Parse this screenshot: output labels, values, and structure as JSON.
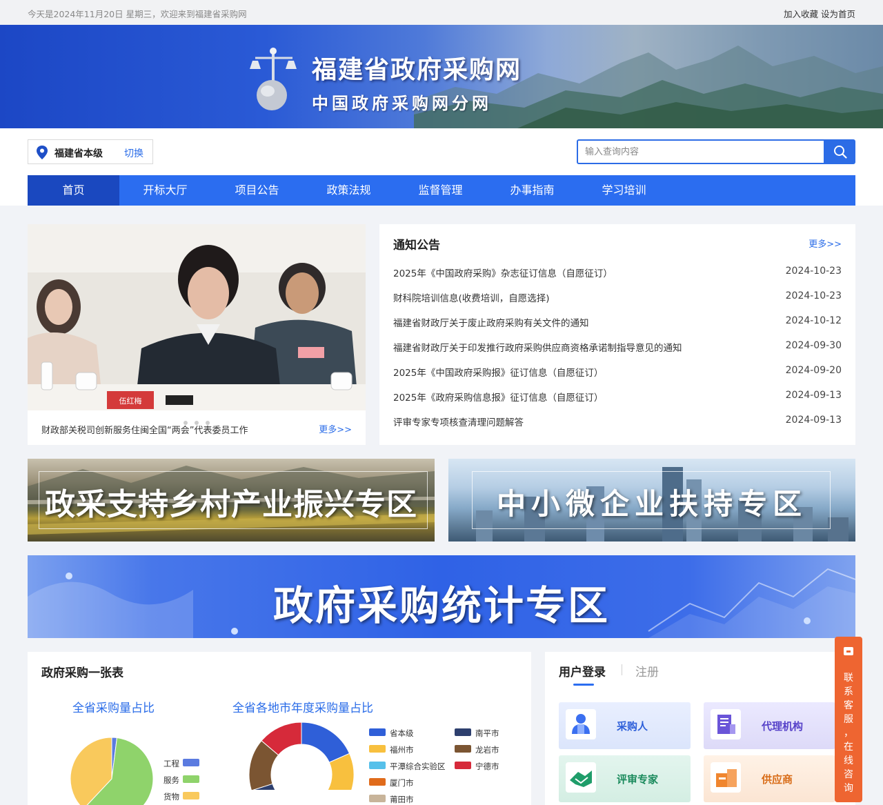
{
  "topbar": {
    "welcome": "今天是2024年11月20日 星期三，欢迎来到福建省采购网",
    "bookmark": "加入收藏",
    "homepage": "设为首页"
  },
  "banner": {
    "title": "福建省政府采购网",
    "subtitle": "中国政府采购网分网"
  },
  "region": {
    "name": "福建省本级",
    "switch_label": "切换"
  },
  "search": {
    "placeholder": "输入查询内容"
  },
  "nav": {
    "items": [
      "首页",
      "开标大厅",
      "项目公告",
      "政策法规",
      "监督管理",
      "办事指南",
      "学习培训"
    ],
    "active": "首页"
  },
  "slider": {
    "caption": "财政部关税司创新服务住闽全国“两会”代表委员工作",
    "more": "更多>>",
    "nameplate": "伍红梅"
  },
  "notices": {
    "title": "通知公告",
    "more": "更多>>",
    "items": [
      {
        "title": "2025年《中国政府采购》杂志征订信息（自愿征订）",
        "date": "2024-10-23"
      },
      {
        "title": "财科院培训信息(收费培训，自愿选择)",
        "date": "2024-10-23"
      },
      {
        "title": "福建省财政厅关于废止政府采购有关文件的通知",
        "date": "2024-10-12"
      },
      {
        "title": "福建省财政厅关于印发推行政府采购供应商资格承诺制指导意见的通知",
        "date": "2024-09-30"
      },
      {
        "title": "2025年《中国政府采购报》征订信息（自愿征订）",
        "date": "2024-09-20"
      },
      {
        "title": "2025年《政府采购信息报》征订信息（自愿征订）",
        "date": "2024-09-13"
      },
      {
        "title": "评审专家专项核查清理问题解答",
        "date": "2024-09-13"
      }
    ]
  },
  "zones": {
    "rural": "政采支持乡村产业振兴专区",
    "sme": "中小微企业扶持专区",
    "stats": "政府采购统计专区"
  },
  "stats": {
    "title": "政府采购一张表",
    "chart1_title": "全省采购量占比",
    "chart2_title": "全省各地市年度采购量占比"
  },
  "chart_data": [
    {
      "type": "pie",
      "title": "全省采购量占比",
      "categories": [
        "工程",
        "服务",
        "货物"
      ],
      "values": [
        2,
        60,
        38
      ],
      "colors": [
        "#5b7be0",
        "#8fd36b",
        "#f9c95c"
      ],
      "legend": "right"
    },
    {
      "type": "pie",
      "title": "全省各地市年度采购量占比",
      "donut": true,
      "categories": [
        "省本级",
        "福州市",
        "平潭综合实验区",
        "厦门市",
        "莆田市",
        "南平市",
        "龙岩市",
        "宁德市"
      ],
      "values": [
        16,
        18,
        1,
        8,
        5,
        13,
        14,
        12
      ],
      "colors": [
        "#2f5fd8",
        "#f8c03e",
        "#56c0ea",
        "#e06b1b",
        "#c8b49a",
        "#2d3f6e",
        "#7b5532",
        "#d62a3a"
      ],
      "legend": "right"
    }
  ],
  "login": {
    "tab_login": "用户登录",
    "tab_register": "注册",
    "roles": [
      "采购人",
      "代理机构",
      "评审专家",
      "供应商"
    ]
  },
  "consult": {
    "text": "联系客服，在线咨询"
  }
}
